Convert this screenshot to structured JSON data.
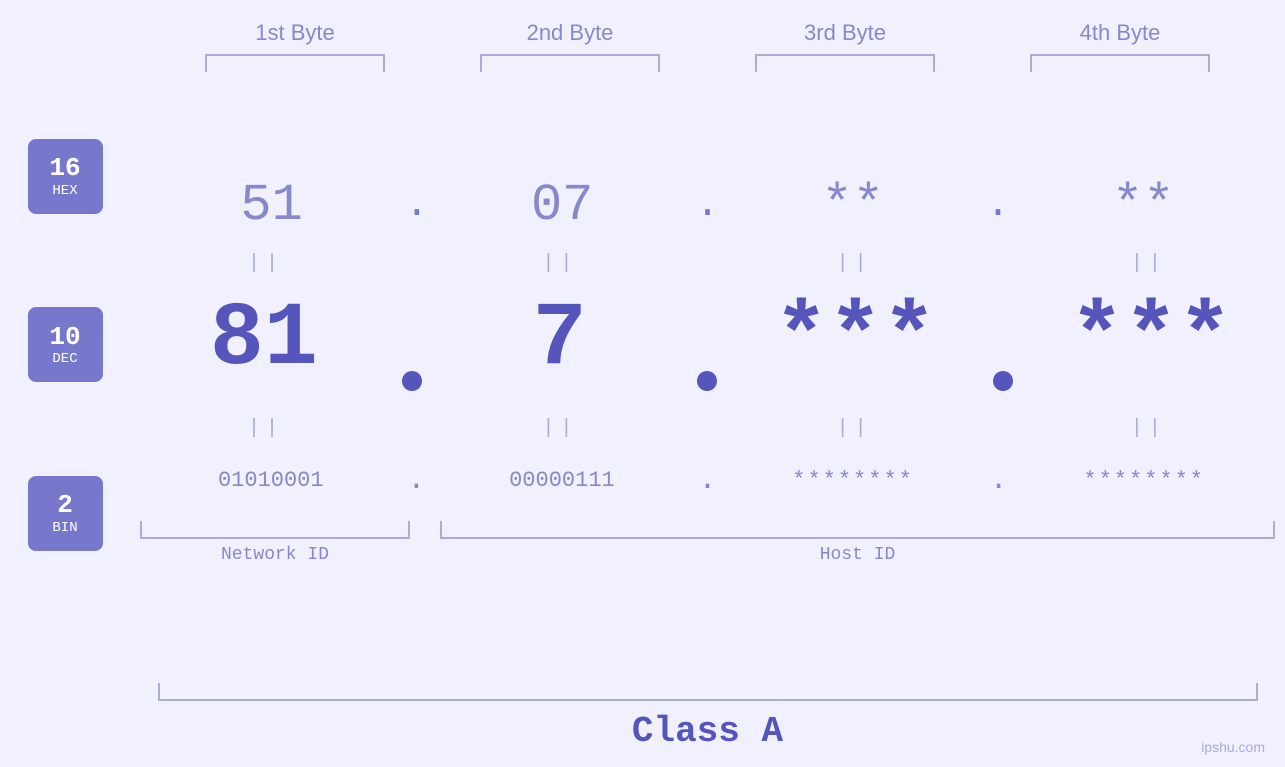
{
  "headers": {
    "col1": "1st Byte",
    "col2": "2nd Byte",
    "col3": "3rd Byte",
    "col4": "4th Byte"
  },
  "badges": {
    "hex": {
      "number": "16",
      "label": "HEX"
    },
    "dec": {
      "number": "10",
      "label": "DEC"
    },
    "bin": {
      "number": "2",
      "label": "BIN"
    }
  },
  "hex_row": {
    "b1": "51",
    "b2": "07",
    "b3": "**",
    "b4": "**",
    "dot": "."
  },
  "dec_row": {
    "b1": "81",
    "b2": "7",
    "b3": "***",
    "b4": "***",
    "dot": "•"
  },
  "bin_row": {
    "b1": "01010001",
    "b2": "00000111",
    "b3": "********",
    "b4": "********",
    "dot": "."
  },
  "separators": {
    "pipe": "||"
  },
  "labels": {
    "network_id": "Network ID",
    "host_id": "Host ID",
    "class": "Class A"
  },
  "watermark": "ipshu.com"
}
